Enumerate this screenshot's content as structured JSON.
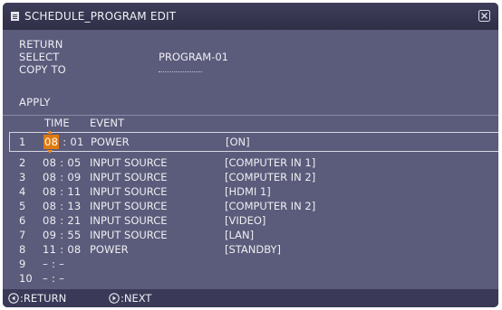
{
  "window": {
    "title": "SCHEDULE_PROGRAM EDIT"
  },
  "menu": {
    "return_label": "RETURN",
    "select_label": "SELECT",
    "select_value": "PROGRAM-01",
    "copy_to_label": "COPY TO",
    "apply_label": "APPLY"
  },
  "table": {
    "time_header": "TIME",
    "event_header": "EVENT",
    "rows": [
      {
        "num": "1",
        "hour": "08",
        "min": "01",
        "event": "POWER",
        "param": "[ON]"
      },
      {
        "num": "2",
        "time": "08 : 05",
        "event": "INPUT SOURCE",
        "param": "[COMPUTER IN 1]"
      },
      {
        "num": "3",
        "time": "08 : 09",
        "event": "INPUT SOURCE",
        "param": "[COMPUTER IN 2]"
      },
      {
        "num": "4",
        "time": "08 : 11",
        "event": "INPUT SOURCE",
        "param": "[HDMI 1]"
      },
      {
        "num": "5",
        "time": "08 : 13",
        "event": "INPUT SOURCE",
        "param": "[COMPUTER IN 2]"
      },
      {
        "num": "6",
        "time": "08 : 21",
        "event": "INPUT SOURCE",
        "param": "[VIDEO]"
      },
      {
        "num": "7",
        "time": "09 : 55",
        "event": "INPUT SOURCE",
        "param": "[LAN]"
      },
      {
        "num": "8",
        "time": "11 : 08",
        "event": "POWER",
        "param": "[STANDBY]"
      },
      {
        "num": "9",
        "time": "– : –",
        "event": "",
        "param": ""
      },
      {
        "num": "10",
        "time": "– : –",
        "event": "",
        "param": ""
      }
    ]
  },
  "footer": {
    "return_label": ":RETURN",
    "next_label": ":NEXT"
  },
  "colors": {
    "background": "#5b5b7b",
    "titlebar": "#2f2f48",
    "highlight": "#e07a10"
  },
  "icons": {
    "title_icon": "document-icon",
    "close_icon": "close-icon",
    "return_icon": "left-arrow-key-icon",
    "next_icon": "right-arrow-key-icon"
  }
}
